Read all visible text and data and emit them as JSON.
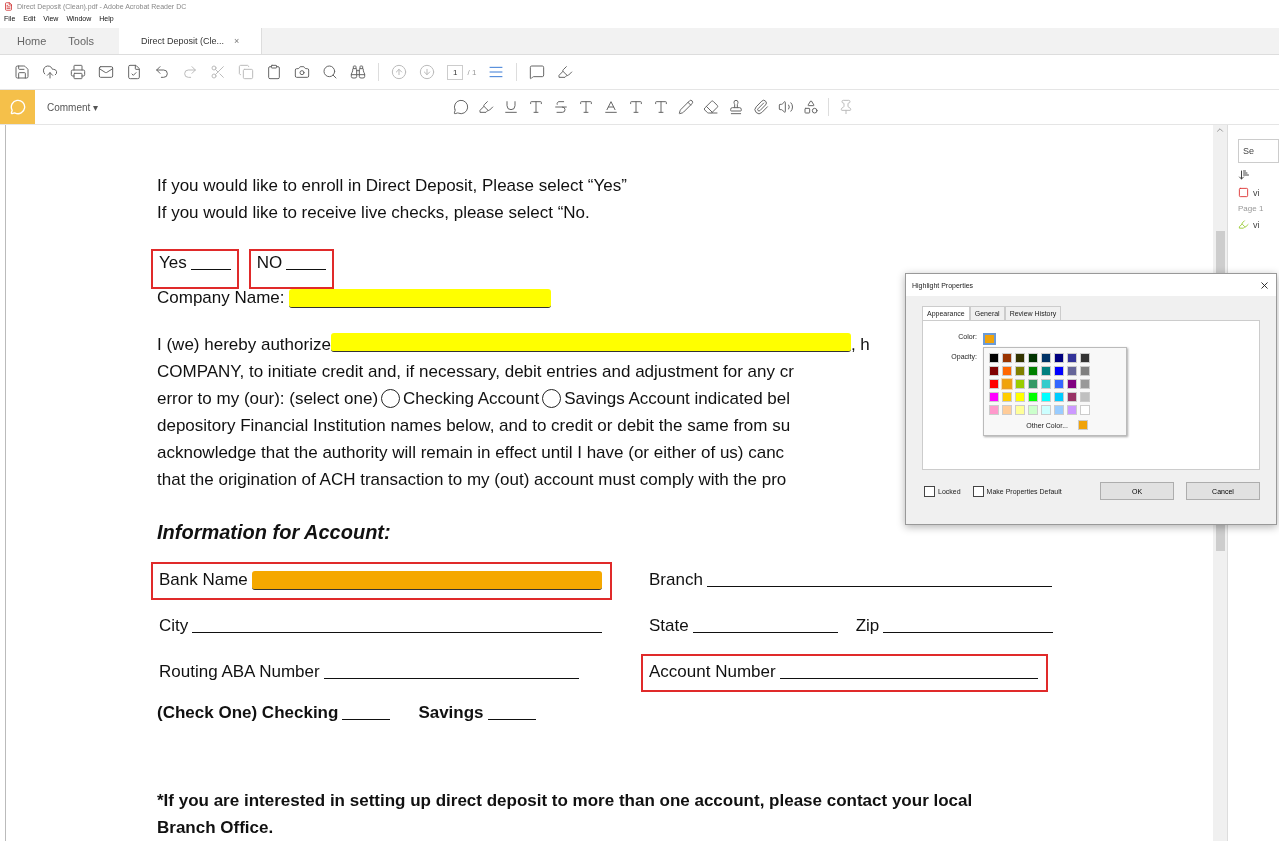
{
  "window": {
    "title": "Direct Deposit (Clean).pdf - Adobe Acrobat Reader DC"
  },
  "menu": [
    "File",
    "Edit",
    "View",
    "Window",
    "Help"
  ],
  "tabs": [
    {
      "label": "Home",
      "selected": false
    },
    {
      "label": "Tools",
      "selected": false
    },
    {
      "label": "Direct Deposit (Cle...",
      "selected": true,
      "close": "×"
    }
  ],
  "toolbar": {
    "page": "1",
    "page_total": "/ 1"
  },
  "comment_bar": {
    "label": "Comment",
    "caret": "▾"
  },
  "document": {
    "intro": [
      "If you would like to enroll in Direct Deposit, Please select “Yes”",
      "If you would like to receive live checks, please select “No."
    ],
    "choices": [
      {
        "label": "Yes",
        "boxed": true
      },
      {
        "label": "NO",
        "boxed": true
      }
    ],
    "company": {
      "label": "Company Name:",
      "color": "#ffff00"
    },
    "paragraph": {
      "lead": "I (we) hereby authorize",
      "color": "#ffff00",
      "lead_end": ", h",
      "lines": [
        "COMPANY, to initiate credit and, if necessary, debit entries and adjustment for any cr"
      ],
      "select_line": {
        "prefix": "error to my (our): (select one)",
        "options": [
          {
            "label": "Checking Account",
            "checked": false
          },
          {
            "label": "Savings Account indicated bel",
            "checked": false
          }
        ]
      },
      "rest": [
        "depository Financial Institution names below, and to credit or debit the same from su",
        "acknowledge that the authority will remain in effect until I have (or either of us) canc",
        "that the origination of ACH transaction to my (out) account must comply with the pro"
      ]
    },
    "heading": "Information for Account:",
    "rows": [
      [
        {
          "label": "Bank Name",
          "boxed": true,
          "color": "#f5a800"
        },
        {
          "label": "Branch",
          "boxed": false
        }
      ],
      [
        {
          "label": "City",
          "boxed": false
        },
        {
          "label": "State",
          "boxed": false
        },
        {
          "label": "Zip",
          "boxed": false
        }
      ],
      [
        {
          "label": "Routing ABA Number",
          "boxed": false
        },
        {
          "label": "Account Number",
          "boxed": true
        }
      ]
    ],
    "check_one": [
      {
        "label": "(Check One) Checking"
      },
      {
        "label": "Savings"
      }
    ],
    "note": "*If you are interested in setting up direct deposit to more than one account, please contact your local Branch Office."
  },
  "right_panel": {
    "search": "Se",
    "items": [
      {
        "kind": "box",
        "text": "vi",
        "page": "Page 1"
      },
      {
        "kind": "pen",
        "text": "vi"
      }
    ]
  },
  "dialog": {
    "title": "Highlight Properties",
    "tabs": [
      {
        "label": "Appearance",
        "selected": true
      },
      {
        "label": "General",
        "selected": false
      },
      {
        "label": "Review History",
        "selected": false
      }
    ],
    "color_label": "Color:",
    "current": {
      "color": "#f0a30a"
    },
    "opacity_label": "Opacity:",
    "palette": [
      {
        "color": "#000000",
        "selected": false
      },
      {
        "color": "#993300",
        "selected": false
      },
      {
        "color": "#333300",
        "selected": false
      },
      {
        "color": "#003300",
        "selected": false
      },
      {
        "color": "#003366",
        "selected": false
      },
      {
        "color": "#000080",
        "selected": false
      },
      {
        "color": "#333399",
        "selected": false
      },
      {
        "color": "#333333",
        "selected": false
      },
      {
        "color": "#800000",
        "selected": false
      },
      {
        "color": "#ff6600",
        "selected": false
      },
      {
        "color": "#808000",
        "selected": false
      },
      {
        "color": "#008000",
        "selected": false
      },
      {
        "color": "#008080",
        "selected": false
      },
      {
        "color": "#0000ff",
        "selected": false
      },
      {
        "color": "#666699",
        "selected": false
      },
      {
        "color": "#808080",
        "selected": false
      },
      {
        "color": "#ff0000",
        "selected": false
      },
      {
        "color": "#f0a30a",
        "selected": true
      },
      {
        "color": "#99cc00",
        "selected": false
      },
      {
        "color": "#339966",
        "selected": false
      },
      {
        "color": "#33cccc",
        "selected": false
      },
      {
        "color": "#3366ff",
        "selected": false
      },
      {
        "color": "#800080",
        "selected": false
      },
      {
        "color": "#999999",
        "selected": false
      },
      {
        "color": "#ff00ff",
        "selected": false
      },
      {
        "color": "#ffcc00",
        "selected": false
      },
      {
        "color": "#ffff00",
        "selected": false
      },
      {
        "color": "#00ff00",
        "selected": false
      },
      {
        "color": "#00ffff",
        "selected": false
      },
      {
        "color": "#00ccff",
        "selected": false
      },
      {
        "color": "#993366",
        "selected": false
      },
      {
        "color": "#c0c0c0",
        "selected": false
      },
      {
        "color": "#ff99cc",
        "selected": false
      },
      {
        "color": "#ffcc99",
        "selected": false
      },
      {
        "color": "#ffff99",
        "selected": false
      },
      {
        "color": "#ccffcc",
        "selected": false
      },
      {
        "color": "#ccffff",
        "selected": false
      },
      {
        "color": "#99ccff",
        "selected": false
      },
      {
        "color": "#cc99ff",
        "selected": false
      },
      {
        "color": "#ffffff",
        "selected": false
      }
    ],
    "other_color": {
      "label": "Other Color...",
      "color": "#f0a30a"
    },
    "checkboxes": [
      {
        "label": "Locked",
        "checked": false
      },
      {
        "label": "Make Properties Default",
        "checked": false
      }
    ],
    "buttons": [
      "OK",
      "Cancel"
    ]
  }
}
